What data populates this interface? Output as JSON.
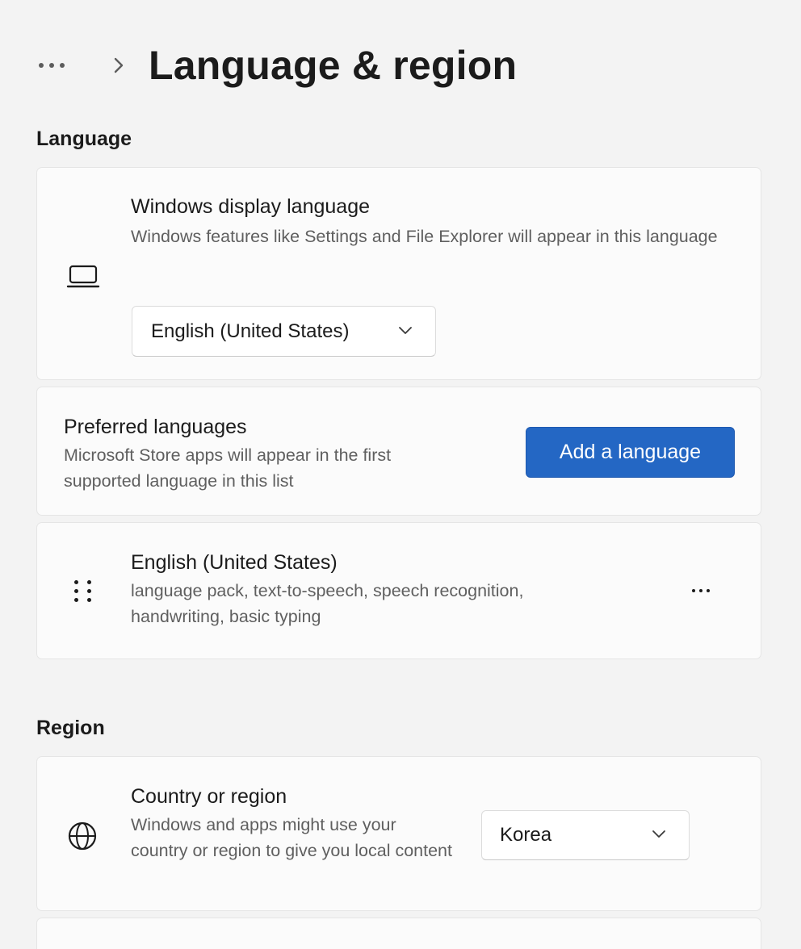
{
  "header": {
    "title": "Language & region"
  },
  "language_section": {
    "heading": "Language",
    "display_language": {
      "title": "Windows display language",
      "description": "Windows features like Settings and File Explorer will appear in this language",
      "selected": "English (United States)",
      "icon": "laptop-icon"
    },
    "preferred_languages": {
      "title": "Preferred languages",
      "description": "Microsoft Store apps will appear in the first supported language in this list",
      "add_button": "Add a language"
    },
    "installed_language": {
      "name": "English (United States)",
      "features": "language pack, text-to-speech, speech recognition, handwriting, basic typing",
      "icon": "drag-handle-icon"
    }
  },
  "region_section": {
    "heading": "Region",
    "country": {
      "title": "Country or region",
      "description": "Windows and apps might use your country or region to give you local content",
      "selected": "Korea",
      "icon": "globe-icon"
    }
  },
  "colors": {
    "accent": "#2467c4",
    "background": "#f3f3f3",
    "card": "#fbfbfb"
  }
}
